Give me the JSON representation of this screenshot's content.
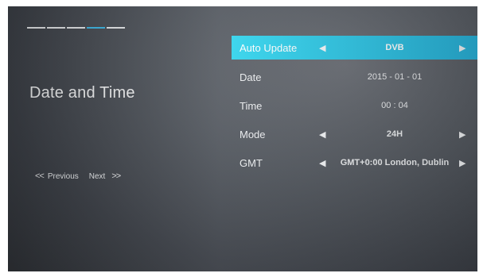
{
  "progress": {
    "segments": 5,
    "active_index": 3
  },
  "sidebar": {
    "title": "Date and Time",
    "prev_arrows": "<<",
    "prev_label": "Previous",
    "next_label": "Next",
    "next_arrows": ">>"
  },
  "settings": [
    {
      "label": "Auto Update",
      "value": "DVB",
      "has_arrows": true,
      "selected": true
    },
    {
      "label": "Date",
      "value": "2015 - 01 - 01",
      "has_arrows": false,
      "selected": false
    },
    {
      "label": "Time",
      "value": "00 : 04",
      "has_arrows": false,
      "selected": false
    },
    {
      "label": "Mode",
      "value": "24H",
      "has_arrows": true,
      "selected": false
    },
    {
      "label": "GMT",
      "value": "GMT+0:00 London, Dublin",
      "has_arrows": true,
      "selected": false
    }
  ],
  "colors": {
    "highlight": "#31c6e6",
    "progress_active": "#3fb8e6",
    "text": "#eceef0"
  },
  "icons": {
    "left_arrow": "triangle-left-icon",
    "right_arrow": "triangle-right-icon"
  }
}
